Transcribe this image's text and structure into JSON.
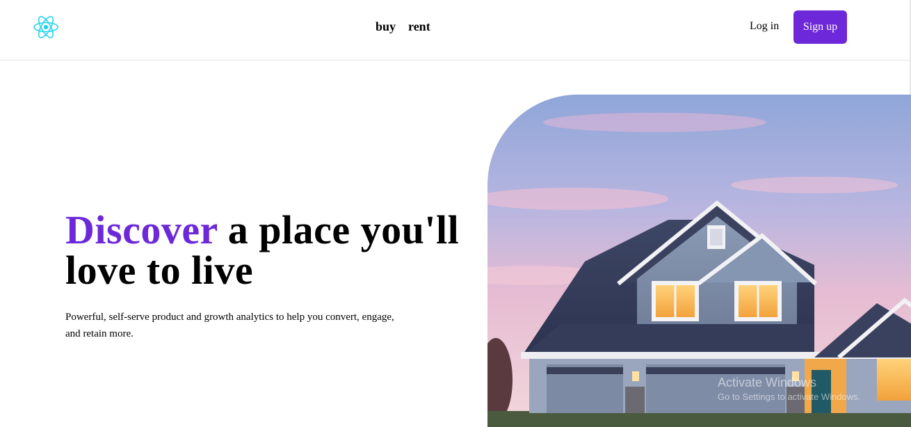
{
  "header": {
    "logo_icon": "react-atom-icon",
    "nav": [
      {
        "label": "buy"
      },
      {
        "label": "rent"
      }
    ],
    "login_label": "Log in",
    "signup_label": "Sign up"
  },
  "hero": {
    "headline_accent": "Discover",
    "headline_rest": " a place you'll love to live",
    "description": "Powerful, self-serve product and growth analytics to help you convert, engage, and retain more.",
    "image_icon": "house-photo"
  },
  "watermark": {
    "title": "Activate Windows",
    "subtitle": "Go to Settings to activate Windows."
  },
  "colors": {
    "accent": "#6d28d9",
    "logo": "#22d3ee",
    "text": "#000000"
  }
}
